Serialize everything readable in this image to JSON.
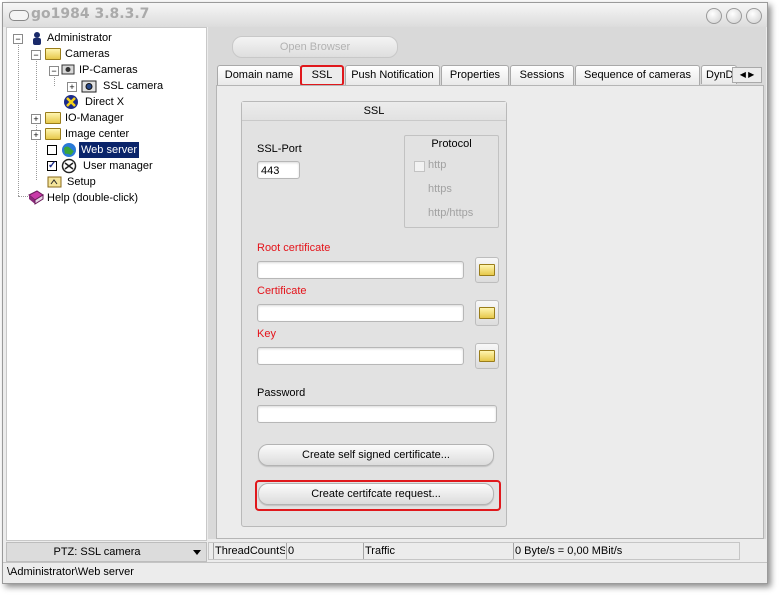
{
  "window": {
    "title": "go1984 3.8.3.7"
  },
  "tree": {
    "items": [
      {
        "id": "administrator",
        "label": "Administrator",
        "icon": "admin-icon"
      },
      {
        "id": "cameras",
        "label": "Cameras",
        "icon": "folder-icon"
      },
      {
        "id": "ip-cameras",
        "label": "IP-Cameras",
        "icon": "ip-camera-icon"
      },
      {
        "id": "ssl-camera",
        "label": "SSL camera",
        "icon": "camera-icon"
      },
      {
        "id": "direct-x",
        "label": "Direct X",
        "icon": "direct-x-icon"
      },
      {
        "id": "io-manager",
        "label": "IO-Manager",
        "icon": "folder-icon"
      },
      {
        "id": "image-center",
        "label": "Image center",
        "icon": "folder-icon"
      },
      {
        "id": "web-server",
        "label": "Web server",
        "icon": "globe-icon",
        "selected": true
      },
      {
        "id": "user-manager",
        "label": "User manager",
        "icon": "user-manager-icon",
        "checked": true
      },
      {
        "id": "setup",
        "label": "Setup",
        "icon": "setup-icon"
      },
      {
        "id": "help",
        "label": "Help (double-click)",
        "icon": "help-book-icon"
      }
    ]
  },
  "ptz": {
    "label": "PTZ: SSL camera"
  },
  "path": "\\Administrator\\Web server",
  "toolbar": {
    "open_browser": "Open Browser"
  },
  "tabs": [
    {
      "label": "Domain name"
    },
    {
      "label": "SSL",
      "active": true
    },
    {
      "label": "Push Notification"
    },
    {
      "label": "Properties"
    },
    {
      "label": "Sessions"
    },
    {
      "label": "Sequence of cameras"
    },
    {
      "label": "DynD"
    }
  ],
  "ssl": {
    "header": "SSL",
    "port_label": "SSL-Port",
    "port_value": "443",
    "protocol": {
      "title": "Protocol",
      "options": [
        "http",
        "https",
        "http/https"
      ]
    },
    "root_cert_label": "Root certificate",
    "root_cert_value": "",
    "cert_label": "Certificate",
    "cert_value": "",
    "key_label": "Key",
    "key_value": "",
    "password_label": "Password",
    "password_value": "",
    "self_signed_button": "Create self signed certificate...",
    "request_button": "Create certifcate request..."
  },
  "status": {
    "thread": "ThreadCountS",
    "count": "0",
    "traffic_label": "Traffic",
    "traffic_value": "0 Byte/s = 0,00 MBit/s"
  },
  "colors": {
    "highlight": "#e0181c",
    "selection": "#0a246a",
    "required_label": "#e4131a"
  }
}
